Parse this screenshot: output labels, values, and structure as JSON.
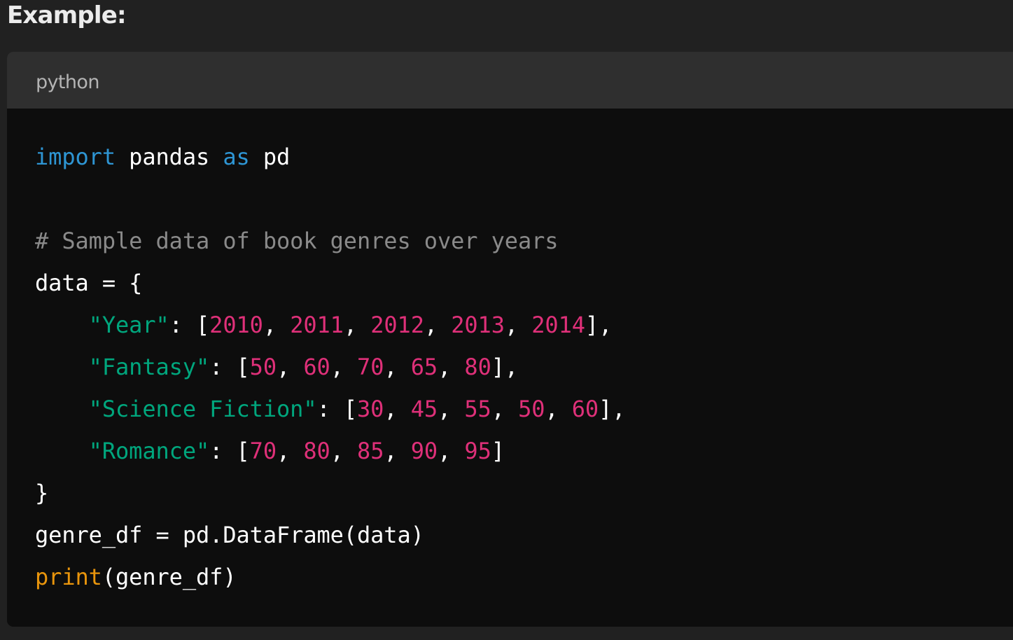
{
  "heading": "Example:",
  "code_block": {
    "language": "python",
    "lines": [
      [
        {
          "t": "import",
          "k": "keyword"
        },
        {
          "t": " pandas ",
          "k": "plain"
        },
        {
          "t": "as",
          "k": "keyword"
        },
        {
          "t": " pd",
          "k": "plain"
        }
      ],
      [],
      [
        {
          "t": "# Sample data of book genres over years",
          "k": "comment"
        }
      ],
      [
        {
          "t": "data = {",
          "k": "plain"
        }
      ],
      [
        {
          "t": "    ",
          "k": "plain"
        },
        {
          "t": "\"Year\"",
          "k": "string"
        },
        {
          "t": ": [",
          "k": "plain"
        },
        {
          "t": "2010",
          "k": "number"
        },
        {
          "t": ", ",
          "k": "plain"
        },
        {
          "t": "2011",
          "k": "number"
        },
        {
          "t": ", ",
          "k": "plain"
        },
        {
          "t": "2012",
          "k": "number"
        },
        {
          "t": ", ",
          "k": "plain"
        },
        {
          "t": "2013",
          "k": "number"
        },
        {
          "t": ", ",
          "k": "plain"
        },
        {
          "t": "2014",
          "k": "number"
        },
        {
          "t": "],",
          "k": "plain"
        }
      ],
      [
        {
          "t": "    ",
          "k": "plain"
        },
        {
          "t": "\"Fantasy\"",
          "k": "string"
        },
        {
          "t": ": [",
          "k": "plain"
        },
        {
          "t": "50",
          "k": "number"
        },
        {
          "t": ", ",
          "k": "plain"
        },
        {
          "t": "60",
          "k": "number"
        },
        {
          "t": ", ",
          "k": "plain"
        },
        {
          "t": "70",
          "k": "number"
        },
        {
          "t": ", ",
          "k": "plain"
        },
        {
          "t": "65",
          "k": "number"
        },
        {
          "t": ", ",
          "k": "plain"
        },
        {
          "t": "80",
          "k": "number"
        },
        {
          "t": "],",
          "k": "plain"
        }
      ],
      [
        {
          "t": "    ",
          "k": "plain"
        },
        {
          "t": "\"Science Fiction\"",
          "k": "string"
        },
        {
          "t": ": [",
          "k": "plain"
        },
        {
          "t": "30",
          "k": "number"
        },
        {
          "t": ", ",
          "k": "plain"
        },
        {
          "t": "45",
          "k": "number"
        },
        {
          "t": ", ",
          "k": "plain"
        },
        {
          "t": "55",
          "k": "number"
        },
        {
          "t": ", ",
          "k": "plain"
        },
        {
          "t": "50",
          "k": "number"
        },
        {
          "t": ", ",
          "k": "plain"
        },
        {
          "t": "60",
          "k": "number"
        },
        {
          "t": "],",
          "k": "plain"
        }
      ],
      [
        {
          "t": "    ",
          "k": "plain"
        },
        {
          "t": "\"Romance\"",
          "k": "string"
        },
        {
          "t": ": [",
          "k": "plain"
        },
        {
          "t": "70",
          "k": "number"
        },
        {
          "t": ", ",
          "k": "plain"
        },
        {
          "t": "80",
          "k": "number"
        },
        {
          "t": ", ",
          "k": "plain"
        },
        {
          "t": "85",
          "k": "number"
        },
        {
          "t": ", ",
          "k": "plain"
        },
        {
          "t": "90",
          "k": "number"
        },
        {
          "t": ", ",
          "k": "plain"
        },
        {
          "t": "95",
          "k": "number"
        },
        {
          "t": "]",
          "k": "plain"
        }
      ],
      [
        {
          "t": "}",
          "k": "plain"
        }
      ],
      [
        {
          "t": "genre_df = pd.DataFrame(data)",
          "k": "plain"
        }
      ],
      [
        {
          "t": "print",
          "k": "builtin"
        },
        {
          "t": "(genre_df)",
          "k": "plain"
        }
      ]
    ]
  },
  "colors": {
    "page_background": "#212121",
    "code_background": "#0d0d0d",
    "header_background": "#2f2f2f",
    "keyword": "#2e95d3",
    "comment": "#8a8a8a",
    "string": "#00a67d",
    "number": "#df3079",
    "builtin": "#e9950c",
    "plain": "#ffffff"
  }
}
